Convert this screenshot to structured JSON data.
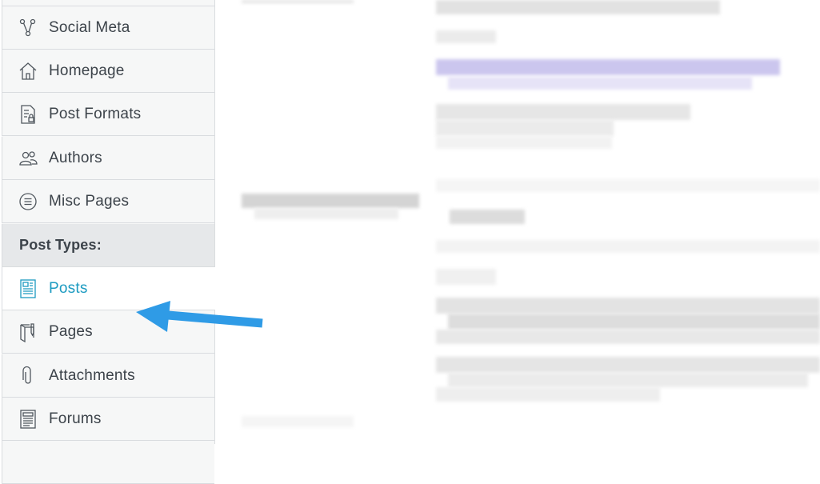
{
  "sidebar": {
    "items": [
      {
        "label": "Social Meta",
        "icon": "share-nodes-icon"
      },
      {
        "label": "Homepage",
        "icon": "home-icon"
      },
      {
        "label": "Post Formats",
        "icon": "document-lock-icon"
      },
      {
        "label": "Authors",
        "icon": "users-icon"
      },
      {
        "label": "Misc Pages",
        "icon": "list-circle-icon"
      }
    ],
    "section_header": "Post Types:",
    "post_types": [
      {
        "label": "Posts",
        "icon": "newspaper-icon",
        "active": true
      },
      {
        "label": "Pages",
        "icon": "page-pen-icon"
      },
      {
        "label": "Attachments",
        "icon": "paperclip-icon"
      },
      {
        "label": "Forums",
        "icon": "forum-doc-icon"
      }
    ]
  },
  "colors": {
    "accent": "#1d9bc1",
    "arrow": "#2f9be6",
    "sidebar_bg": "#f6f7f7",
    "header_bg": "#e6e8ea",
    "border": "#d9dcdf",
    "text": "#3c434a"
  }
}
